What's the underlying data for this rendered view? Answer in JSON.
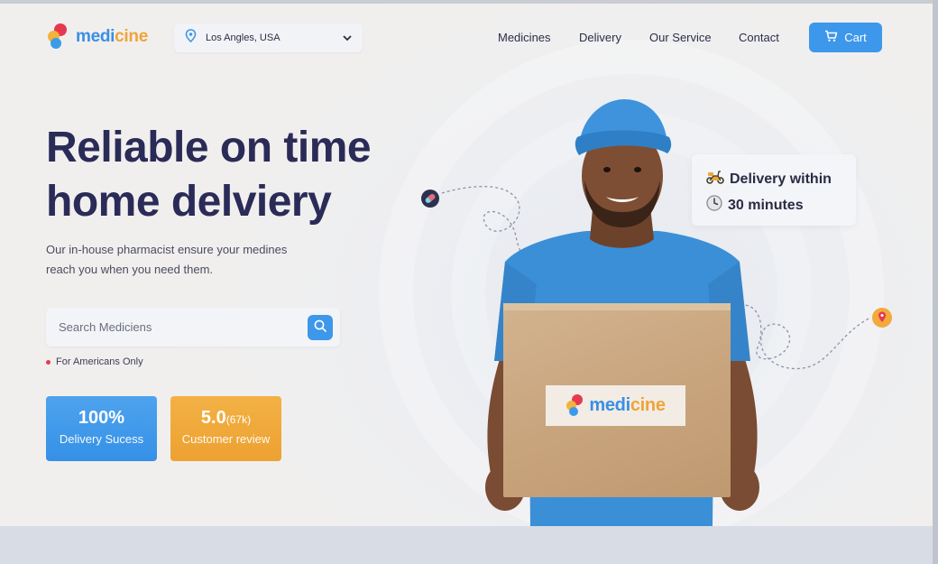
{
  "brand": {
    "part1": "medi",
    "part2": "cine"
  },
  "location": {
    "value": "Los Angles, USA"
  },
  "nav": {
    "items": [
      {
        "label": "Medicines"
      },
      {
        "label": "Delivery"
      },
      {
        "label": "Our Service"
      },
      {
        "label": "Contact"
      }
    ],
    "cart_label": "Cart"
  },
  "hero": {
    "headline_line1": "Reliable on time",
    "headline_line2": "home delviery",
    "subtext_line1": "Our in-house pharmacist ensure your medines",
    "subtext_line2": "reach you when you need them."
  },
  "search": {
    "placeholder": "Search Mediciens"
  },
  "note": "For Americans Only",
  "stats": {
    "delivery": {
      "value": "100%",
      "label": "Delivery Sucess"
    },
    "review": {
      "value": "5.0",
      "count": "(67k)",
      "label": "Customer review"
    }
  },
  "delivery_card": {
    "line1": "Delivery within",
    "line2": "30 minutes"
  },
  "box_label": {
    "part1": "medi",
    "part2": "cine"
  },
  "colors": {
    "accent_blue": "#3d97ea",
    "accent_orange": "#eda131",
    "heading": "#2a2b57",
    "brand_red": "#e53950"
  },
  "icons": {
    "location": "location-pin-icon",
    "dropdown": "chevron-down-icon",
    "cart": "cart-icon",
    "search": "search-icon",
    "scooter": "scooter-icon",
    "clock": "clock-icon",
    "pill": "pill-icon",
    "map_pin": "map-pin-icon"
  }
}
